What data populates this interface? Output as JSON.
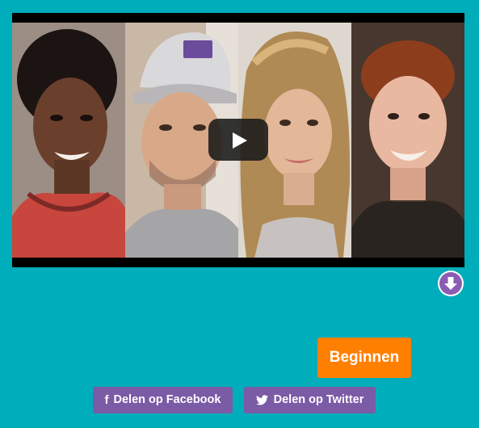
{
  "video": {
    "thumbnails": [
      {
        "icon": "person-portrait-woman-short-hair"
      },
      {
        "icon": "person-portrait-man-cap"
      },
      {
        "icon": "person-portrait-woman-long-hair"
      },
      {
        "icon": "person-portrait-man-curly-hair"
      }
    ],
    "play_icon": "play-icon",
    "colors": {
      "play_button_bg": "#191919"
    }
  },
  "scroll_down": {
    "icon": "arrow-down-icon"
  },
  "cta": {
    "begin_label": "Beginnen",
    "color": "#ff7f00"
  },
  "share": {
    "facebook_label": "Delen op Facebook",
    "twitter_label": "Delen op Twitter",
    "color": "#7b5aa6"
  },
  "colors": {
    "background": "#00adbb"
  }
}
